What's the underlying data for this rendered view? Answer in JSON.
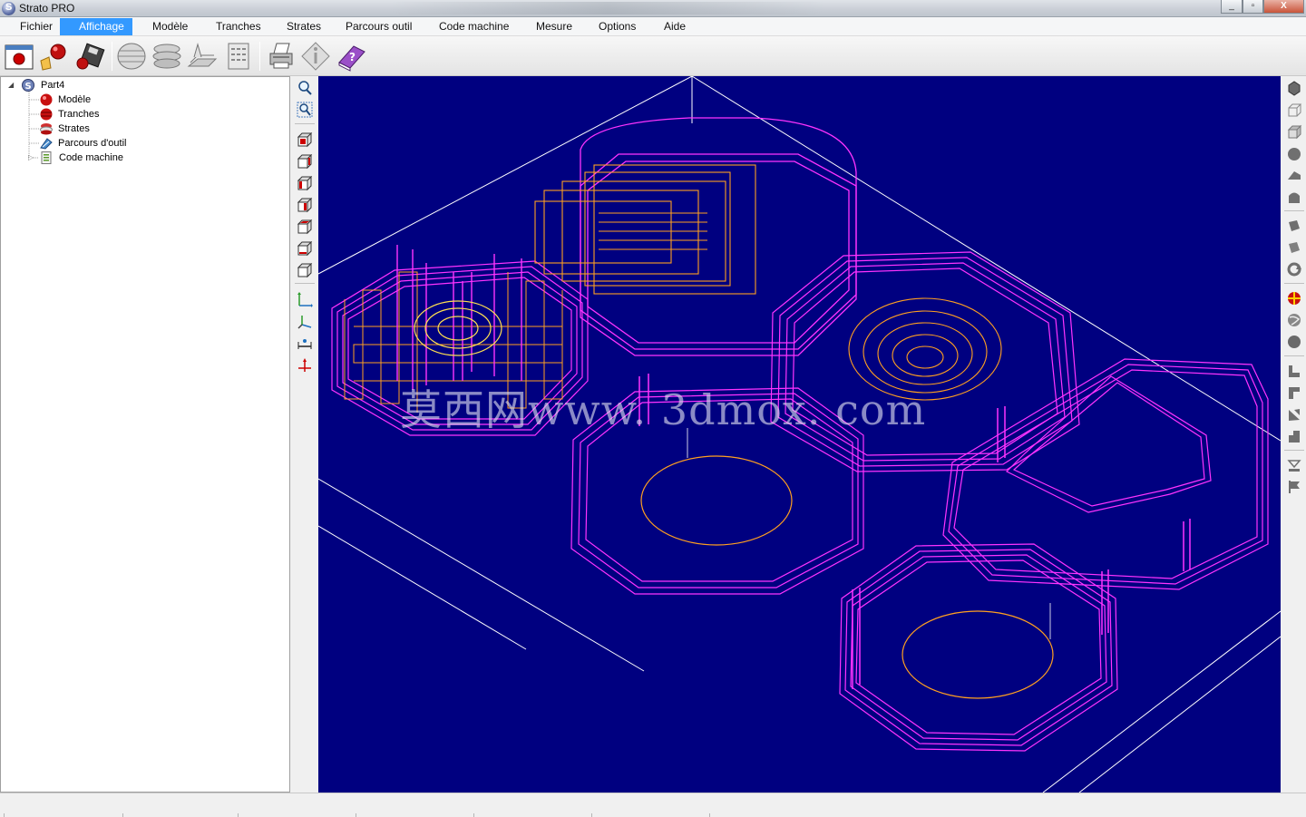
{
  "window": {
    "title": "Strato PRO",
    "buttons": {
      "minimize": "_",
      "maximize": "▫",
      "close": "X"
    }
  },
  "menu": {
    "items": [
      {
        "label": "Fichier",
        "active": false
      },
      {
        "label": "Affichage",
        "active": true
      },
      {
        "label": "Modèle",
        "active": false
      },
      {
        "label": "Tranches",
        "active": false
      },
      {
        "label": "Strates",
        "active": false
      },
      {
        "label": "Parcours outil",
        "active": false
      },
      {
        "label": "Code machine",
        "active": false
      },
      {
        "label": "Mesure",
        "active": false
      },
      {
        "label": "Options",
        "active": false
      },
      {
        "label": "Aide",
        "active": false
      }
    ]
  },
  "toolbar": {
    "buttons": [
      "new-window-icon",
      "open-model-icon",
      "save-disk-icon",
      "sphere-slices-icon",
      "layers-icon",
      "layer-plane-icon",
      "code-sheet-icon",
      "printer-icon",
      "info-diamond-icon",
      "help-book-icon"
    ]
  },
  "tree": {
    "root": "Part4",
    "children": [
      "Modèle",
      "Tranches",
      "Strates",
      "Parcours d'outil",
      "Code machine"
    ]
  },
  "view_toolbar": {
    "buttons": [
      "zoom-window-icon",
      "zoom-fit-icon",
      "view-front-icon",
      "view-back-icon",
      "view-left-icon",
      "view-right-icon",
      "view-top-icon",
      "view-bottom-icon",
      "view-iso-icon",
      "axis-xy-icon",
      "axis-xyz-icon",
      "measure-icon",
      "origin-icon"
    ]
  },
  "render_toolbar": {
    "buttons": [
      "cube-select-icon",
      "wire-box-icon",
      "box-icon",
      "sphere-icon",
      "shade-flat-icon",
      "shade-smooth-icon",
      "solid-a-icon",
      "solid-b-icon",
      "rotate-icon",
      "color-ball-icon",
      "globe-icon",
      "dark-ball-icon",
      "section-a-icon",
      "section-b-icon",
      "section-c-icon",
      "section-d-icon",
      "lasso-icon",
      "flag-icon"
    ]
  },
  "viewport": {
    "watermark": "莫西网www. 3dmox. com",
    "colors": {
      "background": "#000080",
      "stock_outline": "#ffffff",
      "toolpath_magenta": "#ff33ff",
      "toolpath_orange": "#ffa020"
    }
  },
  "colors": {
    "menu_active": "#3399ff"
  }
}
